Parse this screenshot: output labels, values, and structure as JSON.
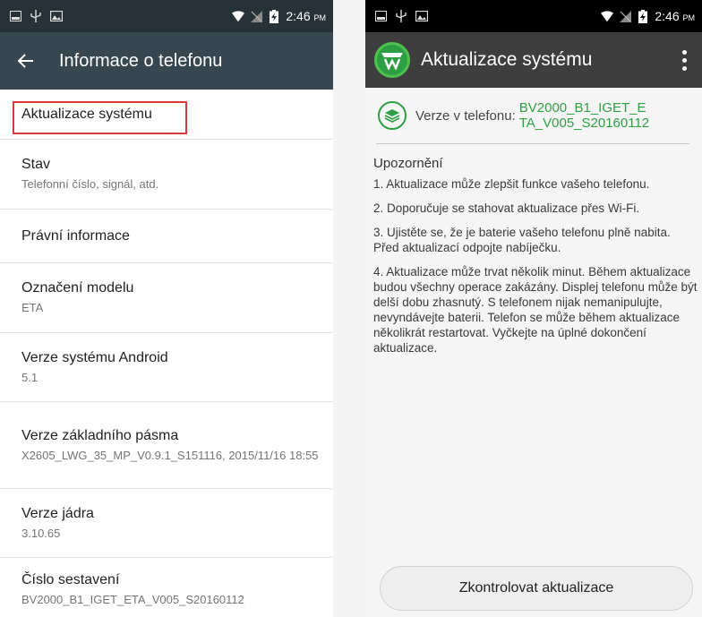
{
  "left": {
    "status": {
      "time": "2:46",
      "ampm": "PM"
    },
    "title": "Informace o telefonu",
    "items": [
      {
        "title": "Aktualizace systému",
        "sub": ""
      },
      {
        "title": "Stav",
        "sub": "Telefonní číslo, signál, atd."
      },
      {
        "title": "Právní informace",
        "sub": ""
      },
      {
        "title": "Označení modelu",
        "sub": "ETA"
      },
      {
        "title": "Verze systému Android",
        "sub": "5.1"
      },
      {
        "title": "Verze základního pásma",
        "sub": "X2605_LWG_35_MP_V0.9.1_S151116, 2015/11/16 18:55"
      },
      {
        "title": "Verze jádra",
        "sub": "3.10.65"
      },
      {
        "title": "Číslo sestavení",
        "sub": "BV2000_B1_IGET_ETA_V005_S20160112"
      }
    ]
  },
  "right": {
    "status": {
      "time": "2:46",
      "ampm": "PM"
    },
    "title": "Aktualizace systému",
    "version_label": "Verze v telefonu:",
    "version_value": "BV2000_B1_IGET_ETA_V005_S20160112",
    "notice_title": "Upozornění",
    "notes": [
      "1. Aktualizace může zlepšit funkce vašeho telefonu.",
      "2. Doporučuje se stahovat aktualizace přes Wi-Fi.",
      "3. Ujistěte se, že je baterie vašeho telefonu plně nabita. Před aktualizací odpojte nabíječku.",
      "4. Aktualizace může trvat několik minut. Během aktualizace budou všechny operace zakázány. Displej telefonu může být delší dobu zhasnutý. S telefonem nijak nemanipulujte, nevyndávejte baterii. Telefon se může během aktualizace několikrát restartovat. Vyčkejte na úplné dokončení aktualizace."
    ],
    "button": "Zkontrolovat aktualizace"
  },
  "colors": {
    "highlight": "#d93a3a",
    "accent_green": "#2ea043",
    "appbar_left": "#37474f",
    "appbar_right": "#3e3e3e"
  },
  "icons": [
    "image-icon",
    "usb-icon",
    "photo-icon",
    "wifi-icon",
    "no-signal-icon",
    "battery-charging-icon",
    "back-arrow-icon",
    "app-logo-icon",
    "overflow-menu-icon",
    "layers-icon"
  ]
}
